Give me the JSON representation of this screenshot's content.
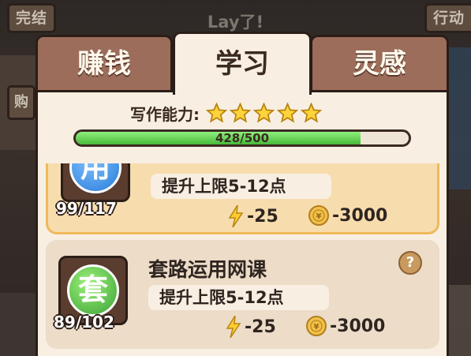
{
  "top_bar": {
    "finish_label": "完结",
    "title": "Lay了!",
    "action_label": "行动",
    "side_stub_label": "购"
  },
  "tabs": [
    {
      "label": "赚钱",
      "active": false
    },
    {
      "label": "学习",
      "active": true
    },
    {
      "label": "灵感",
      "active": false
    }
  ],
  "ability": {
    "label": "写作能力:",
    "stars": 5,
    "progress_text": "428/500",
    "progress_value": 428,
    "progress_max": 500
  },
  "courses": [
    {
      "icon_char": "用",
      "icon_color": "#2a7cd8",
      "count": "99/117",
      "name": "",
      "effect": "提升上限5-12点",
      "energy_cost": "-25",
      "money_cost": "-3000",
      "highlighted": true
    },
    {
      "icon_char": "套",
      "icon_color": "#3aa336",
      "count": "89/102",
      "name": "套路运用网课",
      "effect": "提升上限5-12点",
      "energy_cost": "-25",
      "money_cost": "-3000",
      "highlighted": false,
      "help": "?"
    }
  ],
  "colors": {
    "active_tab": "#f8efe2",
    "inactive_tab": "#9c6d5a",
    "highlight_border": "#f0b95c",
    "progress_fill": "#48b93a"
  }
}
